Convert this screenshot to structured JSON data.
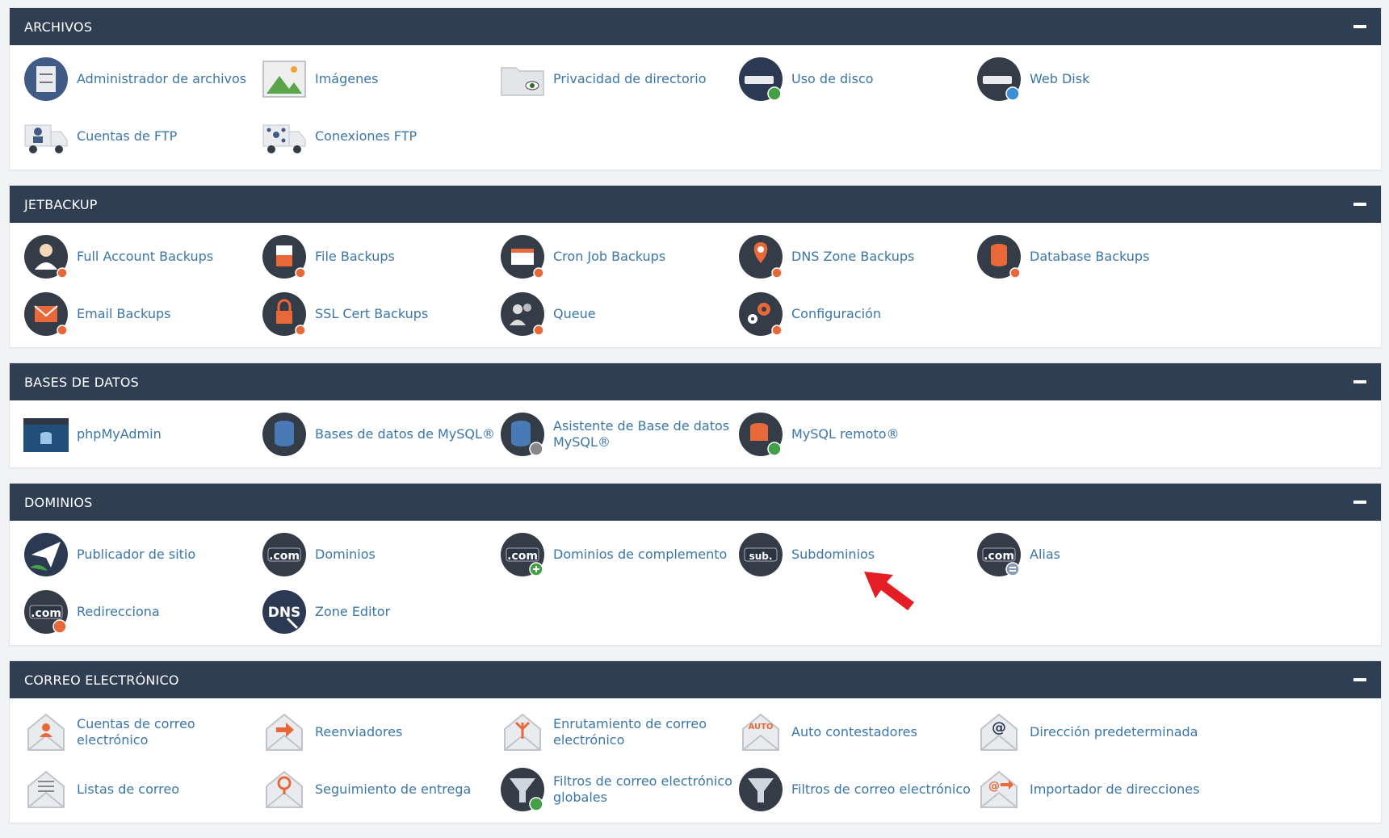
{
  "colors": {
    "header_bg": "#2f3e52",
    "link": "#3b76a8",
    "icon_dark": "#343c48",
    "accent_orange": "#e8683a",
    "accent_green": "#43a047",
    "pointer_arrow": "#e31e24"
  },
  "sections": [
    {
      "id": "archivos",
      "title": "ARCHIVOS",
      "rows": [
        [
          {
            "label": "Administrador de archivos",
            "icon": "file-cabinet-icon"
          },
          {
            "label": "Imágenes",
            "icon": "image-icon"
          },
          {
            "label": "Privacidad de directorio",
            "icon": "folder-eye-icon"
          },
          {
            "label": "Uso de disco",
            "icon": "disk-usage-icon"
          },
          {
            "label": "Web Disk",
            "icon": "web-disk-icon"
          }
        ],
        [
          {
            "label": "Cuentas de FTP",
            "icon": "ftp-accounts-icon"
          },
          {
            "label": "Conexiones FTP",
            "icon": "ftp-connections-icon"
          }
        ]
      ]
    },
    {
      "id": "jetbackup",
      "title": "JETBACKUP",
      "rows": [
        [
          {
            "label": "Full Account Backups",
            "icon": "user-backup-icon"
          },
          {
            "label": "File Backups",
            "icon": "file-backup-icon"
          },
          {
            "label": "Cron Job Backups",
            "icon": "cron-backup-icon"
          },
          {
            "label": "DNS Zone Backups",
            "icon": "dns-pin-backup-icon"
          },
          {
            "label": "Database Backups",
            "icon": "database-backup-icon"
          }
        ],
        [
          {
            "label": "Email Backups",
            "icon": "email-backup-icon"
          },
          {
            "label": "SSL Cert Backups",
            "icon": "lock-backup-icon"
          },
          {
            "label": "Queue",
            "icon": "queue-users-icon"
          },
          {
            "label": "Configuración",
            "icon": "gears-icon"
          }
        ]
      ]
    },
    {
      "id": "bases-de-datos",
      "title": "BASES DE DATOS",
      "rows": [
        [
          {
            "label": "phpMyAdmin",
            "icon": "phpmyadmin-icon"
          },
          {
            "label": "Bases de datos de MySQL®",
            "icon": "mysql-database-icon"
          },
          {
            "label": "Asistente de Base de datos MySQL®",
            "icon": "database-wizard-icon"
          },
          {
            "label": "MySQL remoto®",
            "icon": "remote-mysql-icon"
          }
        ]
      ]
    },
    {
      "id": "dominios",
      "title": "DOMINIOS",
      "rows": [
        [
          {
            "label": "Publicador de sitio",
            "icon": "paper-plane-icon"
          },
          {
            "label": "Dominios",
            "icon": "com-domains-icon",
            "badge": ".com"
          },
          {
            "label": "Dominios de complemento",
            "icon": "addon-domains-icon",
            "badge": ".com"
          },
          {
            "label": "Subdominios",
            "icon": "subdomains-icon",
            "badge": "sub."
          },
          {
            "label": "Alias",
            "icon": "alias-icon",
            "badge": ".com"
          }
        ],
        [
          {
            "label": "Redirecciona",
            "icon": "redirects-icon",
            "badge": ".com"
          },
          {
            "label": "Zone Editor",
            "icon": "dns-zone-editor-icon",
            "badge": "DNS"
          }
        ]
      ]
    },
    {
      "id": "correo",
      "title": "CORREO ELECTRÓNICO",
      "rows": [
        [
          {
            "label": "Cuentas de correo electrónico",
            "icon": "email-accounts-icon"
          },
          {
            "label": "Reenviadores",
            "icon": "forwarders-icon"
          },
          {
            "label": "Enrutamiento de correo electrónico",
            "icon": "email-routing-icon"
          },
          {
            "label": "Auto contestadores",
            "icon": "autoresponders-icon",
            "badge": "AUTO"
          },
          {
            "label": "Dirección predeterminada",
            "icon": "default-address-icon",
            "badge": "@"
          }
        ],
        [
          {
            "label": "Listas de correo",
            "icon": "mailing-lists-icon"
          },
          {
            "label": "Seguimiento de entrega",
            "icon": "track-delivery-icon"
          },
          {
            "label": "Filtros de correo electrónico globales",
            "icon": "global-filters-icon"
          },
          {
            "label": "Filtros de correo electrónico",
            "icon": "email-filters-icon"
          },
          {
            "label": "Importador de direcciones",
            "icon": "address-importer-icon",
            "badge": "@"
          }
        ]
      ]
    }
  ]
}
